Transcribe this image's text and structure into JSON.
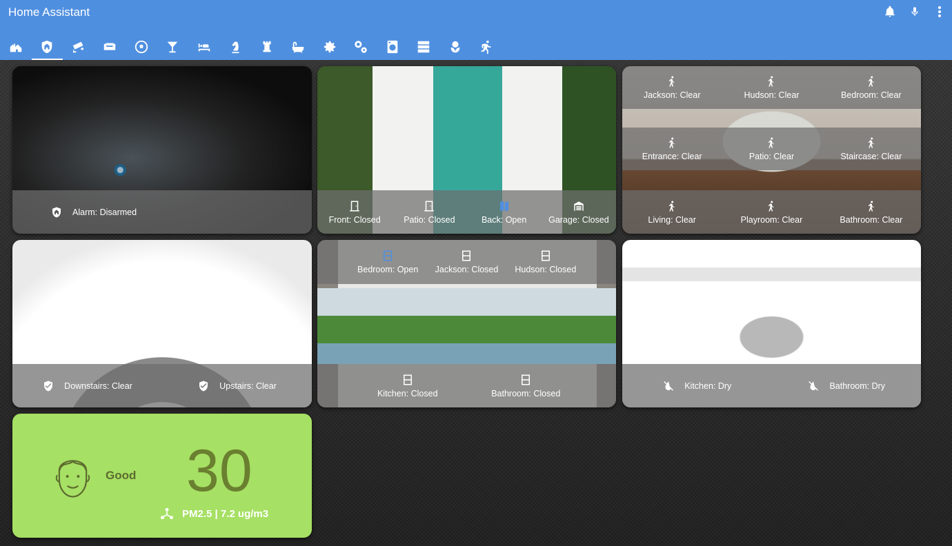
{
  "header": {
    "title": "Home Assistant",
    "actions": [
      {
        "name": "notifications-icon"
      },
      {
        "name": "microphone-icon"
      },
      {
        "name": "overflow-menu-icon"
      }
    ]
  },
  "tabs": [
    {
      "icon": "home-icon",
      "active": false
    },
    {
      "icon": "shield-home-icon",
      "active": true
    },
    {
      "icon": "cctv-icon",
      "active": false
    },
    {
      "icon": "sofa-icon",
      "active": false
    },
    {
      "icon": "soccer-icon",
      "active": false
    },
    {
      "icon": "cocktail-icon",
      "active": false
    },
    {
      "icon": "bed-icon",
      "active": false
    },
    {
      "icon": "chess-knight-icon",
      "active": false
    },
    {
      "icon": "chess-rook-icon",
      "active": false
    },
    {
      "icon": "bathtub-icon",
      "active": false
    },
    {
      "icon": "gear-icon",
      "active": false
    },
    {
      "icon": "gears-icon",
      "active": false
    },
    {
      "icon": "washing-machine-icon",
      "active": false
    },
    {
      "icon": "server-icon",
      "active": false
    },
    {
      "icon": "flower-icon",
      "active": false
    },
    {
      "icon": "run-icon",
      "active": false
    }
  ],
  "cards": {
    "alarm": {
      "label": "Alarm: Disarmed",
      "icon": "shield-home-icon"
    },
    "doors": [
      {
        "label": "Front: Closed",
        "icon": "door-closed-icon",
        "color": "#ffffff"
      },
      {
        "label": "Patio: Closed",
        "icon": "door-closed-icon",
        "color": "#ffffff"
      },
      {
        "label": "Back: Open",
        "icon": "door-open-icon",
        "color": "#4f8fe0"
      },
      {
        "label": "Garage: Closed",
        "icon": "garage-icon",
        "color": "#ffffff"
      }
    ],
    "motion": [
      [
        "Jackson: Clear",
        "Hudson: Clear",
        "Bedroom: Clear"
      ],
      [
        "Entrance: Clear",
        "Patio: Clear",
        "Staircase: Clear"
      ],
      [
        "Living: Clear",
        "Playroom: Clear",
        "Bathroom: Clear"
      ]
    ],
    "smoke": [
      {
        "label": "Downstairs: Clear",
        "icon": "shield-check-icon"
      },
      {
        "label": "Upstairs: Clear",
        "icon": "shield-check-icon"
      }
    ],
    "windows_top": [
      {
        "label": "Bedroom: Open",
        "icon": "window-open-icon",
        "color": "#4f8fe0"
      },
      {
        "label": "Jackson: Closed",
        "icon": "window-closed-icon",
        "color": "#ffffff"
      },
      {
        "label": "Hudson: Closed",
        "icon": "window-closed-icon",
        "color": "#ffffff"
      }
    ],
    "windows_bottom": [
      {
        "label": "Kitchen: Closed",
        "icon": "window-closed-icon",
        "color": "#ffffff"
      },
      {
        "label": "Bathroom: Closed",
        "icon": "window-closed-icon",
        "color": "#ffffff"
      }
    ],
    "leak": [
      {
        "label": "Kitchen: Dry",
        "icon": "water-off-icon"
      },
      {
        "label": "Bathroom: Dry",
        "icon": "water-off-icon"
      }
    ],
    "air": {
      "status": "Good",
      "value": "30",
      "detail": "PM2.5 | 7.2 ug/m3",
      "icon_face": "face-icon",
      "icon_detail": "molecule-icon",
      "bg": "#a6e064"
    }
  }
}
